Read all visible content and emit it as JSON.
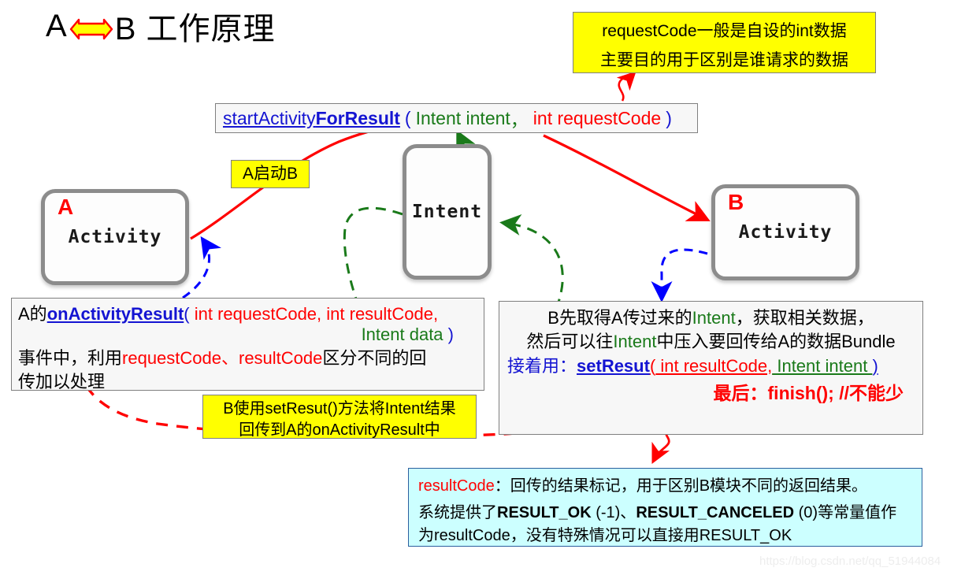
{
  "title": {
    "left": "A",
    "right": "B 工作原理",
    "arrow_icon": "double-arrow-icon"
  },
  "nodes": {
    "a_activity": {
      "tag": "A",
      "label": "Activity"
    },
    "b_activity": {
      "tag": "B",
      "label": "Activity"
    },
    "intent": {
      "label": "Intent"
    }
  },
  "signature": {
    "part1": "startActivity",
    "part2": "ForResult",
    "open_paren": "(",
    "arg1": "Intent intent",
    "comma": "，",
    "arg2": "int requestCode",
    "close_paren": ")"
  },
  "top_note": {
    "line1": "requestCode一般是自设的int数据",
    "line2": "主要目的用于区别是谁请求的数据"
  },
  "start_label": {
    "text": "A启动B"
  },
  "left_box": {
    "prefix": "A的",
    "method": "onActivityResult",
    "open_paren": "(",
    "args1": " int requestCode, int resultCode,",
    "args2": "Intent data",
    "close_paren": ")",
    "line3_a": "事件中，利用",
    "line3_b": "requestCode、resultCode",
    "line3_c": "区分不同的回",
    "line4": "传加以处理"
  },
  "right_box": {
    "line1_a": "B先取得A传过来的",
    "line1_b": "Intent",
    "line1_c": "，获取相关数据，",
    "line2_a": "然后可以往",
    "line2_b": "Intent",
    "line2_c": "中压入要回传给A的数据Bundle",
    "line3_a": "接着用：",
    "line3_method": "setResut",
    "line3_open": "(",
    "line3_arg1": " int resultCode,",
    "line3_arg2": " Intent intent ",
    "line3_close": ")",
    "line4": "最后：finish(); //不能少"
  },
  "setresut_note": {
    "line1": "B使用setResut()方法将Intent结果",
    "line2": "回传到A的onActivityResult中"
  },
  "bottom_note": {
    "line1_a": "resultCode",
    "line1_b": "：回传的结果标记，用于区别B模块不同的返回结果。",
    "line2_a": "系统提供了",
    "line2_b": "RESULT_OK",
    "line2_c": " (-1)、",
    "line2_d": "RESULT_CANCELED",
    "line2_e": " (0)等常量值作",
    "line3": "为resultCode，没有特殊情况可以直接用RESULT_OK"
  },
  "watermark": {
    "text": "https://blog.csdn.net/qq_51944084"
  },
  "colors": {
    "red": "#ff0000",
    "blue": "#1414d2",
    "green": "#1a7a1a",
    "yellow": "#ffff00",
    "cyan": "#ccffff",
    "box_border": "#7f7f7f",
    "node_border": "#8c8c8c"
  }
}
